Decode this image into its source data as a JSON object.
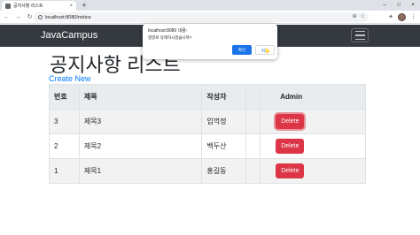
{
  "browser": {
    "tab_title": "공지사항 리스트",
    "tab_close": "×",
    "new_tab": "+",
    "url": "localhost:8080/notice",
    "window_controls": [
      "–",
      "□",
      "×"
    ]
  },
  "navbar": {
    "brand": "JavaCampus"
  },
  "page": {
    "title": "공지사항 리스트",
    "create_link": "Create New"
  },
  "table": {
    "headers": [
      "번호",
      "제목",
      "작성자",
      "",
      "Admin"
    ],
    "rows": [
      {
        "no": "3",
        "title": "제목3",
        "writer": "임꺽정",
        "action": "Delete"
      },
      {
        "no": "2",
        "title": "제목2",
        "writer": "백두산",
        "action": "Delete"
      },
      {
        "no": "1",
        "title": "제목1",
        "writer": "홍길동",
        "action": "Delete"
      }
    ]
  },
  "dialog": {
    "title": "localhost:8080 내용:",
    "message": "정말로 삭제하시겠습니까?",
    "confirm_label": "확인",
    "cancel_label": "취소"
  },
  "colors": {
    "navbar": "#343a40",
    "danger": "#dc3545",
    "link": "#007bff",
    "dialog_primary": "#1a73e8"
  }
}
